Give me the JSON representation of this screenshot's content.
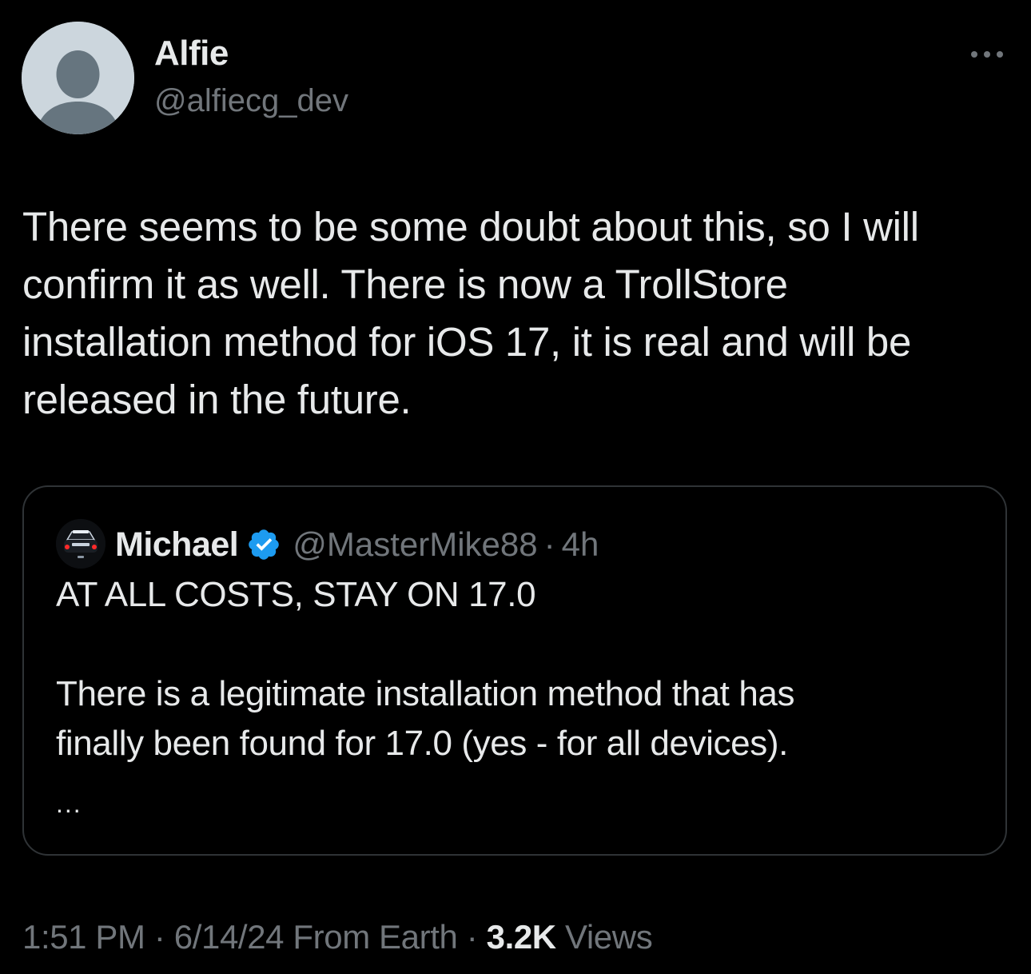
{
  "author": {
    "name": "Alfie",
    "handle": "@alfiecg_dev",
    "avatar_icon": "default-profile-silhouette-icon"
  },
  "more_icon": "more-horizontal-icon",
  "tweet": {
    "text_lines": [
      "There seems to be some doubt about this, so I will",
      "confirm it as well. There is now a TrollStore",
      "installation method for iOS 17, it is real and will be",
      "released in the future."
    ]
  },
  "quoted_tweet": {
    "avatar_icon": "police-car-avatar-icon",
    "name": "Michael",
    "verified_icon": "verified-badge-icon",
    "handle": "@MasterMike88",
    "separator": "·",
    "time": "4h",
    "text_lines": [
      "AT ALL COSTS, STAY ON 17.0",
      "",
      "There is a legitimate installation method that has",
      "finally been found for 17.0 (yes - for all devices)."
    ],
    "ellipsis": "..."
  },
  "meta": {
    "time": "1:51 PM",
    "sep1": "·",
    "date": "6/14/24",
    "source": "From Earth",
    "sep2": "·",
    "views_count": "3.2K",
    "views_label": "Views"
  },
  "colors": {
    "background": "#000000",
    "primary_text": "#e7e9ea",
    "secondary_text": "#71767b",
    "border": "#2f3336",
    "verified_blue": "#1d9bf0"
  }
}
